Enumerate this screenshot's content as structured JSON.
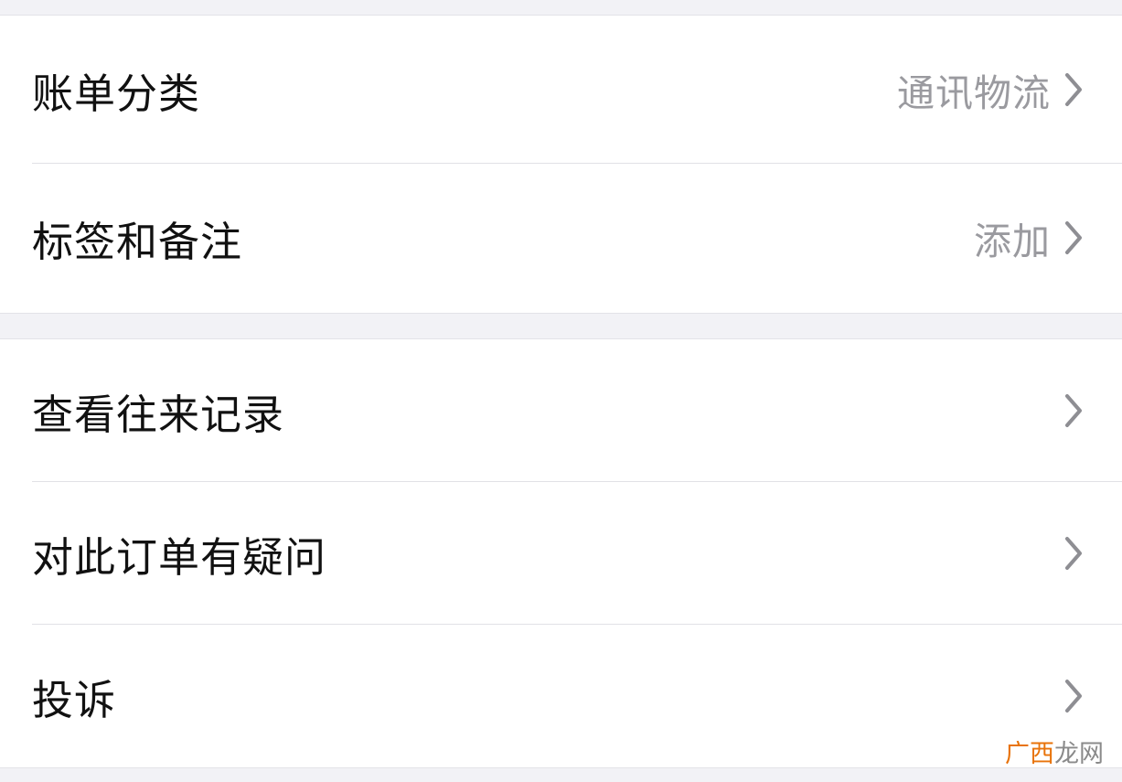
{
  "colors": {
    "background": "#f2f2f6",
    "card": "#ffffff",
    "label_text": "#111111",
    "value_text": "#9a9a9f",
    "chevron": "#8e8e93",
    "separator": "#e1e1e6",
    "watermark_accent": "#e8730a",
    "watermark_gray": "#8a8a8a"
  },
  "section1": {
    "rows": [
      {
        "label": "账单分类",
        "value": "通讯物流",
        "icon": "chevron-right-icon"
      },
      {
        "label": "标签和备注",
        "value": "添加",
        "icon": "chevron-right-icon"
      }
    ]
  },
  "section2": {
    "rows": [
      {
        "label": "查看往来记录",
        "icon": "chevron-right-icon"
      },
      {
        "label": "对此订单有疑问",
        "icon": "chevron-right-icon"
      },
      {
        "label": "投诉",
        "icon": "chevron-right-icon"
      }
    ]
  },
  "watermark": {
    "part1": "广西",
    "part2": "龙网"
  }
}
